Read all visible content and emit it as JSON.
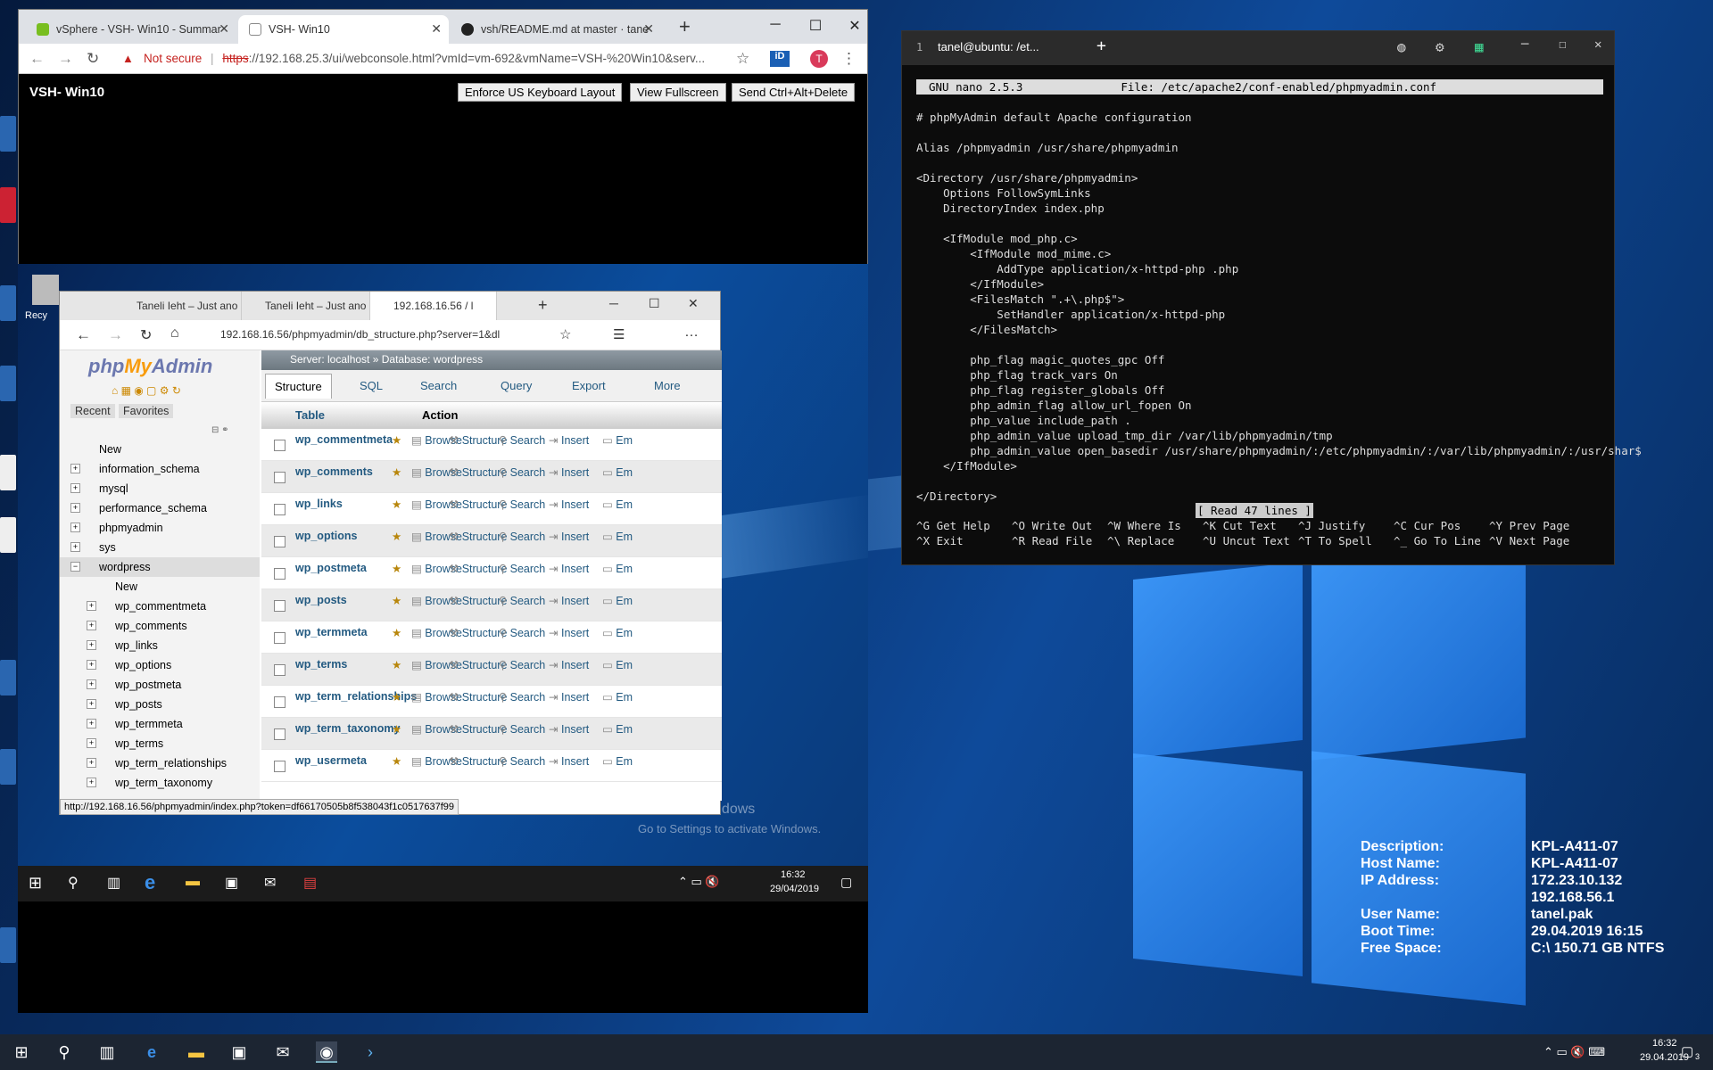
{
  "chrome": {
    "tabs": [
      {
        "label": "vSphere - VSH- Win10 - Summar",
        "close": "✕"
      },
      {
        "label": "VSH- Win10",
        "close": "✕"
      },
      {
        "label": "vsh/README.md at master · tane",
        "close": "✕"
      }
    ],
    "new_tab": "+",
    "not_secure": "Not secure",
    "url_scheme": "https",
    "url_rest": "://192.168.25.3/ui/webconsole.html?vmId=vm-692&vmName=VSH-%20Win10&serv...",
    "avatar_letter": "T",
    "vm_title": "VSH- Win10",
    "buttons": [
      "Enforce US Keyboard Layout",
      "View Fullscreen",
      "Send Ctrl+Alt+Delete"
    ]
  },
  "edge": {
    "tabs": [
      "Taneli Ieht – Just ano",
      "Taneli Ieht – Just ano",
      "192.168.16.56 / l"
    ],
    "url": "192.168.16.56/phpmyadmin/db_structure.php?server=1&dl",
    "status_url": "http://192.168.16.56/phpmyadmin/index.php?token=df66170505b8f538043f1c0517637f99"
  },
  "pma": {
    "logo_php": "php",
    "logo_my": "My",
    "logo_admin": "Admin",
    "recent": "Recent",
    "favorites": "Favorites",
    "tree": [
      {
        "label": "New"
      },
      {
        "label": "information_schema"
      },
      {
        "label": "mysql"
      },
      {
        "label": "performance_schema"
      },
      {
        "label": "phpmyadmin"
      },
      {
        "label": "sys"
      },
      {
        "label": "wordpress"
      }
    ],
    "subtree": [
      "New",
      "wp_commentmeta",
      "wp_comments",
      "wp_links",
      "wp_options",
      "wp_postmeta",
      "wp_posts",
      "wp_termmeta",
      "wp_terms",
      "wp_term_relationships",
      "wp_term_taxonomy"
    ],
    "breadcrumb_server": "Server: localhost",
    "breadcrumb_sep": "»",
    "breadcrumb_db": "Database: wordpress",
    "tabs": [
      "Structure",
      "SQL",
      "Search",
      "Query",
      "Export",
      "More"
    ],
    "col_table": "Table",
    "col_action": "Action",
    "actions": [
      "Browse",
      "Structure",
      "Search",
      "Insert",
      "Em"
    ],
    "rows": [
      "wp_commentmeta",
      "wp_comments",
      "wp_links",
      "wp_options",
      "wp_postmeta",
      "wp_posts",
      "wp_termmeta",
      "wp_terms",
      "wp_term_relationships",
      "wp_term_taxonomy",
      "wp_usermeta"
    ]
  },
  "vm": {
    "watermark_title": "Activate Windows",
    "watermark_sub": "Go to Settings to activate Windows.",
    "clock_time": "16:32",
    "clock_date": "29/04/2019",
    "recycle": "Recy"
  },
  "terminal": {
    "tab_num": "1",
    "tab_title": "tanel@ubuntu: /et...",
    "nano_ver": "GNU nano 2.5.3",
    "file": "File: /etc/apache2/conf-enabled/phpmyadmin.conf",
    "lines": [
      "# phpMyAdmin default Apache configuration",
      "",
      "Alias /phpmyadmin /usr/share/phpmyadmin",
      "",
      "<Directory /usr/share/phpmyadmin>",
      "    Options FollowSymLinks",
      "    DirectoryIndex index.php",
      "",
      "    <IfModule mod_php.c>",
      "        <IfModule mod_mime.c>",
      "            AddType application/x-httpd-php .php",
      "        </IfModule>",
      "        <FilesMatch \".+\\.php$\">",
      "            SetHandler application/x-httpd-php",
      "        </FilesMatch>",
      "",
      "        php_flag magic_quotes_gpc Off",
      "        php_flag track_vars On",
      "        php_flag register_globals Off",
      "        php_admin_flag allow_url_fopen On",
      "        php_value include_path .",
      "        php_admin_value upload_tmp_dir /var/lib/phpmyadmin/tmp",
      "        php_admin_value open_basedir /usr/share/phpmyadmin/:/etc/phpmyadmin/:/var/lib/phpmyadmin/:/usr/shar$",
      "    </IfModule>",
      "",
      "</Directory>"
    ],
    "read_msg": "[ Read 47 lines ]",
    "shortcuts_row1": [
      "^G Get Help",
      "^O Write Out",
      "^W Where Is",
      "^K Cut Text",
      "^J Justify",
      "^C Cur Pos",
      "^Y Prev Page"
    ],
    "shortcuts_row2": [
      "^X Exit",
      "^R Read File",
      "^\\ Replace",
      "^U Uncut Text",
      "^T To Spell",
      "^_ Go To Line",
      "^V Next Page"
    ]
  },
  "sysinfo": {
    "labels": [
      "Description:",
      "Host Name:",
      "IP Address:",
      "",
      "User Name:",
      "Boot Time:",
      "Free Space:"
    ],
    "values": [
      "KPL-A411-07",
      "KPL-A411-07",
      "172.23.10.132",
      "192.168.56.1",
      "tanel.pak",
      "29.04.2019 16:15",
      "C:\\ 150.71 GB NTFS"
    ]
  },
  "taskbar": {
    "time": "16:32",
    "date": "29.04.2019",
    "notif_count": "3"
  }
}
